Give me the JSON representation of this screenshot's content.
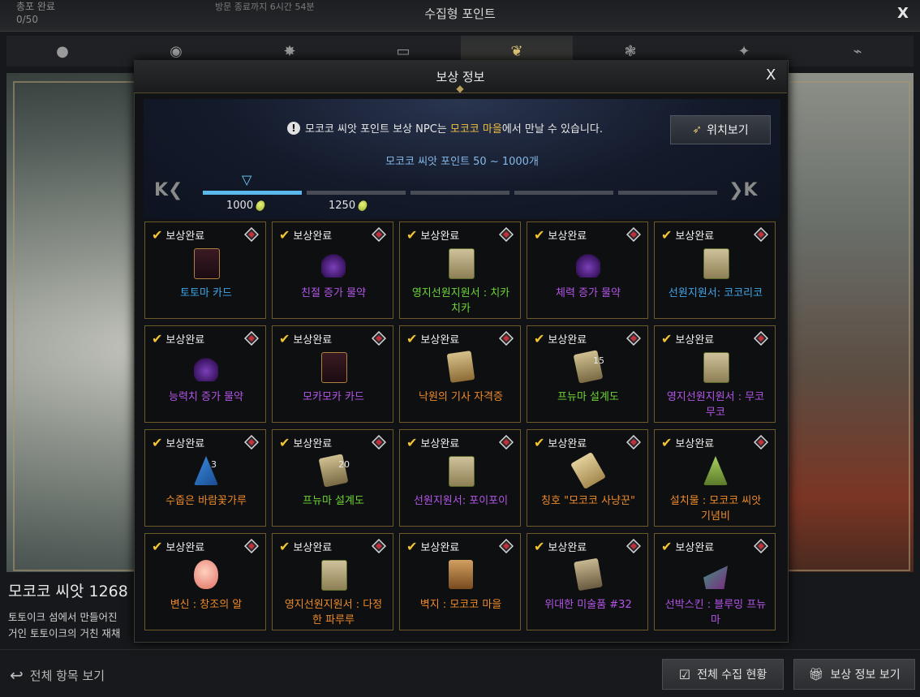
{
  "outer": {
    "title": "수집형 포인트",
    "close": "X",
    "top_left_label": "총포 완료",
    "top_left_count": "0/50",
    "top_notice": "방문 종료까지 6시간 54분"
  },
  "art": {
    "title": "모코코 씨앗 1268",
    "desc_line1": "토토이크 섬에서 만들어진",
    "desc_line2": "거인 토토이크의 거친 재채"
  },
  "bottom": {
    "view_all": "전체 항목 보기",
    "collection_status": "전체 수집 현황",
    "reward_info": "보상 정보 보기"
  },
  "modal": {
    "title": "보상 정보",
    "close": "X",
    "notice_prefix": "모코코 씨앗 포인트 보상 NPC는 ",
    "notice_highlight": "모코코 마을",
    "notice_suffix": "에서 만날 수 있습니다.",
    "locate_button": "위치보기",
    "range_text": "모코코 씨앗 포인트 50 ~ 1000개",
    "milestones": [
      "1000",
      "1250"
    ],
    "progress_filled_segments": 1,
    "total_segments": 5
  },
  "status_label": "보상완료",
  "items": [
    {
      "name": "토토마 카드",
      "color": "blue",
      "icon": "card-icon",
      "badge": ""
    },
    {
      "name": "친절 증가 물약",
      "color": "purple",
      "icon": "potion-icon",
      "badge": ""
    },
    {
      "name": "영지선원지원서 : 치카\n치카",
      "color": "green",
      "icon": "scroll-icon",
      "badge": ""
    },
    {
      "name": "체력 증가 물약",
      "color": "purple",
      "icon": "potion-icon",
      "badge": ""
    },
    {
      "name": "선원지원서: 코코리코",
      "color": "blue",
      "icon": "scroll-icon",
      "badge": ""
    },
    {
      "name": "능력치 증가 물약",
      "color": "purple",
      "icon": "potion-icon",
      "badge": ""
    },
    {
      "name": "모카모카 카드",
      "color": "purple",
      "icon": "card-icon",
      "badge": ""
    },
    {
      "name": "낙원의 기사 자격증",
      "color": "orange",
      "icon": "certificate-icon",
      "badge": ""
    },
    {
      "name": "프뉴마 설계도",
      "color": "green",
      "icon": "blueprint-icon",
      "badge": "15"
    },
    {
      "name": "영지선원지원서 : 무코\n무코",
      "color": "purple",
      "icon": "scroll-icon",
      "badge": ""
    },
    {
      "name": "수줍은 바람꽃가루",
      "color": "orange",
      "icon": "powder-icon",
      "badge": "3"
    },
    {
      "name": "프뉴마 설계도",
      "color": "green",
      "icon": "blueprint-icon",
      "badge": "20"
    },
    {
      "name": "선원지원서: 포이포이",
      "color": "purple",
      "icon": "scroll-icon",
      "badge": ""
    },
    {
      "name": "칭호 \"모코코 사냥꾼\"",
      "color": "orange",
      "icon": "title-scroll-icon",
      "badge": ""
    },
    {
      "name": "설치물 : 모코코 씨앗\n기념비",
      "color": "orange",
      "icon": "statue-icon",
      "badge": ""
    },
    {
      "name": "변신 : 창조의 알",
      "color": "orange",
      "icon": "egg-icon",
      "badge": ""
    },
    {
      "name": "영지선원지원서 : 다정\n한 파루루",
      "color": "orange",
      "icon": "scroll-icon",
      "badge": ""
    },
    {
      "name": "벽지 : 모코코 마을",
      "color": "orange",
      "icon": "wallpaper-icon",
      "badge": ""
    },
    {
      "name": "위대한 미술품 #32",
      "color": "purple",
      "icon": "painting-icon",
      "badge": ""
    },
    {
      "name": "선박스킨 : 블루밍 프뉴\n마",
      "color": "purple",
      "icon": "ship-skin-icon",
      "badge": ""
    }
  ],
  "colors": {
    "accent_gold": "#f3c52d",
    "progress_blue": "#5ab8ec",
    "highlight_yellow": "#f0c040",
    "item_blue": "#3fa6e8",
    "item_purple": "#b455e8",
    "item_green": "#6ed437",
    "item_orange": "#ed8a2a"
  }
}
